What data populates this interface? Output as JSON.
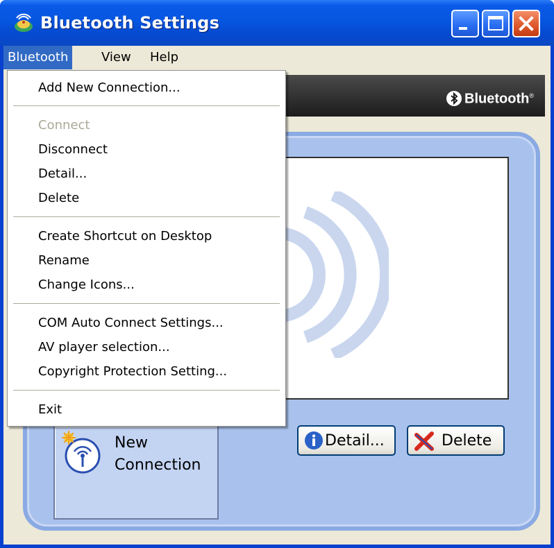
{
  "window": {
    "title": "Bluetooth Settings",
    "icon": "bluetooth-settings-app-icon"
  },
  "titlebar_buttons": {
    "minimize": "minimize-icon",
    "maximize": "maximize-icon",
    "close": "close-icon"
  },
  "menubar": {
    "items": [
      {
        "label": "Bluetooth",
        "active": true
      },
      {
        "label": "View",
        "active": false
      },
      {
        "label": "Help",
        "active": false
      }
    ]
  },
  "banner": {
    "logo_text": "Bluetooth",
    "logo_mark": "®"
  },
  "dropdown": {
    "groups": [
      [
        {
          "label": "Add New Connection...",
          "enabled": true
        }
      ],
      [
        {
          "label": "Connect",
          "enabled": false
        },
        {
          "label": "Disconnect",
          "enabled": true
        },
        {
          "label": "Detail...",
          "enabled": true
        },
        {
          "label": "Delete",
          "enabled": true
        }
      ],
      [
        {
          "label": "Create Shortcut on Desktop",
          "enabled": true
        },
        {
          "label": "Rename",
          "enabled": true
        },
        {
          "label": "Change Icons...",
          "enabled": true
        }
      ],
      [
        {
          "label": "COM Auto Connect Settings...",
          "enabled": true
        },
        {
          "label": "AV player selection...",
          "enabled": true
        },
        {
          "label": "Copyright Protection Setting...",
          "enabled": true
        }
      ],
      [
        {
          "label": "Exit",
          "enabled": true
        }
      ]
    ]
  },
  "buttons": {
    "new_connection_line1": "New",
    "new_connection_line2": "Connection",
    "detail": "Detail...",
    "delete": "Delete"
  },
  "colors": {
    "title_bar": "#0656e0",
    "menu_highlight": "#316ac5",
    "panel": "#a9c2ed",
    "disabled_text": "#aca899"
  }
}
